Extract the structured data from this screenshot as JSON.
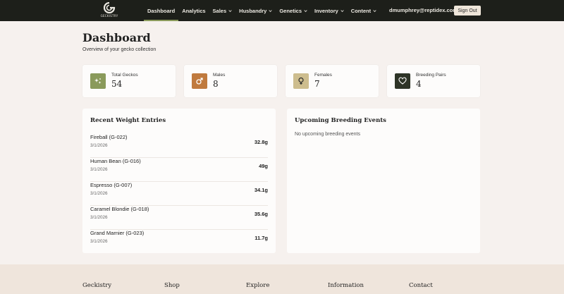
{
  "nav": {
    "logo_text": "GECKISTRY",
    "items": [
      {
        "label": "Dashboard",
        "dropdown": false,
        "active": true
      },
      {
        "label": "Analytics",
        "dropdown": false,
        "active": false
      },
      {
        "label": "Sales",
        "dropdown": true,
        "active": false
      },
      {
        "label": "Husbandry",
        "dropdown": true,
        "active": false
      },
      {
        "label": "Genetics",
        "dropdown": true,
        "active": false
      },
      {
        "label": "Inventory",
        "dropdown": true,
        "active": false
      },
      {
        "label": "Content",
        "dropdown": true,
        "active": false
      }
    ],
    "user_email": "dmumphrey@reptidex.com",
    "signout_label": "Sign Out"
  },
  "header": {
    "title": "Dashboard",
    "subtitle": "Overview of your gecko collection"
  },
  "stats": [
    {
      "label": "Total Geckos",
      "value": "54",
      "icon": "sparkle-icon",
      "color": "#8a9a5b"
    },
    {
      "label": "Males",
      "value": "8",
      "icon": "male-icon",
      "color": "#c07a3e"
    },
    {
      "label": "Females",
      "value": "7",
      "icon": "female-icon",
      "color": "#cdbd8e"
    },
    {
      "label": "Breeding Pairs",
      "value": "4",
      "icon": "heart-icon",
      "color": "#2e3427"
    }
  ],
  "weights": {
    "title": "Recent Weight Entries",
    "entries": [
      {
        "name": "Fireball (G-022)",
        "date": "3/1/2026",
        "value": "32.8g"
      },
      {
        "name": "Human Bean (G-016)",
        "date": "3/1/2026",
        "value": "49g"
      },
      {
        "name": "Espresso (G-007)",
        "date": "3/1/2026",
        "value": "34.1g"
      },
      {
        "name": "Caramel Blondie (G-018)",
        "date": "3/1/2026",
        "value": "35.6g"
      },
      {
        "name": "Grand Marnier (G-023)",
        "date": "3/1/2026",
        "value": "11.7g"
      }
    ]
  },
  "breeding": {
    "title": "Upcoming Breeding Events",
    "empty": "No upcoming breeding events"
  },
  "footer": {
    "columns": [
      "Geckistry",
      "Shop",
      "Explore",
      "Information",
      "Contact"
    ]
  }
}
